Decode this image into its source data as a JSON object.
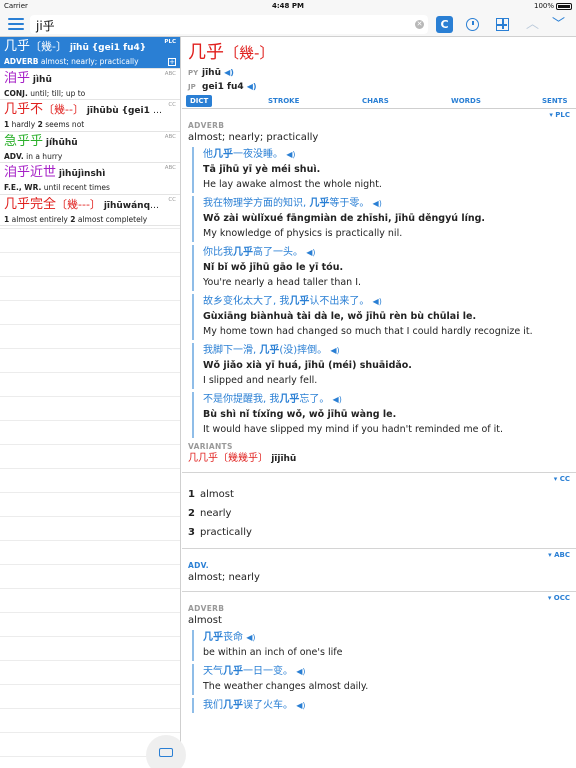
{
  "status": {
    "carrier": "Carrier",
    "time": "4:48 PM",
    "battery": "100%"
  },
  "search": {
    "query": "ji乎"
  },
  "toolbar": {
    "c_label": "C"
  },
  "results": [
    {
      "hz": "几乎",
      "bk": "〔幾-〕",
      "py": "jīhū",
      "jp": "{gei1 fu4}",
      "pos": "ADVERB",
      "gloss": "almost; nearly; practically",
      "tag": "PLC",
      "selected": true
    },
    {
      "hz": "洎乎",
      "py": "jìhū",
      "pos": "CONJ.",
      "gloss": "until; till; up to",
      "tag": "ABC"
    },
    {
      "hz": "几乎不",
      "bk": "〔幾--〕",
      "py": "jīhūbù",
      "jp": "{gei1 fu...",
      "n1": "1",
      "g1": "hardly",
      "n2": "2",
      "g2": "seems not",
      "tag": "CC"
    },
    {
      "hz": "急乎乎",
      "py": "jíhūhū",
      "pos": "ADV.",
      "gloss": "in a hurry",
      "tag": "ABC"
    },
    {
      "hz": "洎乎近世",
      "py": "jìhūjìnshì",
      "pos": "F.E., WR.",
      "gloss": "until recent times",
      "tag": "ABC"
    },
    {
      "hz": "几乎完全",
      "bk": "〔幾---〕",
      "py": "jīhūwánqu...",
      "n1": "1",
      "g1": "almost entirely",
      "n2": "2",
      "g2": "almost completely",
      "tag": "CC"
    }
  ],
  "entry": {
    "word": "几乎",
    "trad": "〔幾-〕",
    "py_label": "PY",
    "py": "jīhū",
    "jp_label": "JP",
    "jp": "gei1 fu4",
    "tabs": [
      "DICT",
      "STROKE",
      "CHARS",
      "WORDS",
      "SENTS"
    ]
  },
  "plc": {
    "tag": "▾ PLC",
    "pos": "ADVERB",
    "def": "almost; nearly; practically",
    "examples": [
      {
        "pre": "他",
        "hl": "几乎",
        "post": "一夜没睡。",
        "py": "Tā jīhū yī yè méi shuì.",
        "en": "He lay awake almost the whole night."
      },
      {
        "pre": "我在物理学方面的知识, ",
        "hl": "几乎",
        "post": "等于零。",
        "py": "Wǒ zài wùlǐxué fāngmiàn de zhīshi, jīhū děngyú líng.",
        "en": "My knowledge of physics is practically nil."
      },
      {
        "pre": "你比我",
        "hl": "几乎",
        "post": "高了一头。",
        "py": "Nǐ bǐ wǒ jīhū gāo le yī tóu.",
        "en": "You're nearly a head taller than I."
      },
      {
        "pre": "故乡变化太大了, 我",
        "hl": "几乎",
        "post": "认不出来了。",
        "py": "Gùxiāng biànhuà tài dà le, wǒ jīhū rèn bù chūlai le.",
        "en": "My home town had changed so much that I could hardly recognize it."
      },
      {
        "pre": "我脚下一滑, ",
        "hl": "几乎",
        "post": "(没)摔倒。",
        "py": "Wǒ jiǎo xià yī huá, jīhū (méi) shuāidǎo.",
        "en": "I slipped and nearly fell."
      },
      {
        "pre": "不是你提醒我, 我",
        "hl": "几乎",
        "post": "忘了。",
        "py": "Bù shì nǐ tíxǐng wǒ, wǒ jīhū wàng le.",
        "en": "It would have slipped my mind if you hadn't reminded me of it."
      }
    ],
    "variants_label": "VARIANTS",
    "variant_hz": "几几乎",
    "variant_bk": "〔幾幾乎〕",
    "variant_py": "jījīhū"
  },
  "cc": {
    "tag": "▾ CC",
    "items": [
      {
        "n": "1",
        "t": "almost"
      },
      {
        "n": "2",
        "t": "nearly"
      },
      {
        "n": "3",
        "t": "practically"
      }
    ]
  },
  "abc": {
    "tag": "▾ ABC",
    "pos": "ADV.",
    "def": "almost; nearly"
  },
  "occ": {
    "tag": "▾ OCC",
    "pos": "ADVERB",
    "def": "almost",
    "examples": [
      {
        "pre": "",
        "hl": "几乎",
        "post": "丧命",
        "en": "be within an inch of one's life"
      },
      {
        "pre": "天气",
        "hl": "几乎",
        "post": "一日一变。",
        "en": "The weather changes almost daily."
      },
      {
        "pre": "我们",
        "hl": "几乎",
        "post": "误了火车。",
        "en": ""
      }
    ]
  },
  "speaker_icon": "speaker-icon"
}
